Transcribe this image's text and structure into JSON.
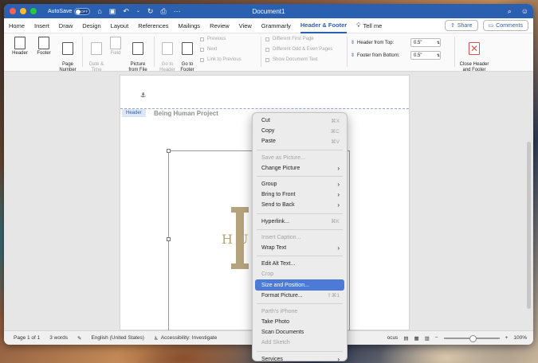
{
  "window": {
    "title": "Document1",
    "autosave_label": "AutoSave",
    "autosave_state": "OFF"
  },
  "menubar": {
    "tabs": [
      "Home",
      "Insert",
      "Draw",
      "Design",
      "Layout",
      "References",
      "Mailings",
      "Review",
      "View",
      "Grammarly",
      "Header & Footer"
    ],
    "active_tab": "Header & Footer",
    "tell_me": "Tell me",
    "share": "Share",
    "comments": "Comments"
  },
  "ribbon": {
    "header": "Header",
    "footer": "Footer",
    "page_number": "Page\nNumber",
    "date_time": "Date &\nTime",
    "field": "Field",
    "picture_from_file": "Picture\nfrom File",
    "go_to_header": "Go to\nHeader",
    "go_to_footer": "Go to\nFooter",
    "previous": "Previous",
    "next": "Next",
    "link_to_previous": "Link to Previous",
    "different_first_page": "Different First Page",
    "different_odd_even": "Different Odd & Even Pages",
    "show_document_text": "Show Document Text",
    "header_from_top_label": "Header from Top:",
    "header_from_top_value": "0.5\"",
    "footer_from_bottom_label": "Footer from Bottom:",
    "footer_from_bottom_value": "0.5\"",
    "close_header_footer": "Close Header\nand Footer"
  },
  "document": {
    "header_tag": "Header",
    "header_text": "Being Human Project",
    "logo_text": "HU"
  },
  "status": {
    "page": "Page 1 of 1",
    "words": "3 words",
    "language": "English (United States)",
    "accessibility": "Accessibility: Investigate",
    "focus": "ocus",
    "zoom": "100%"
  },
  "context_menu": [
    {
      "label": "Cut",
      "shortcut": "⌘X"
    },
    {
      "label": "Copy",
      "shortcut": "⌘C"
    },
    {
      "label": "Paste",
      "shortcut": "⌘V"
    },
    {
      "sep": true
    },
    {
      "label": "Save as Picture...",
      "disabled": true
    },
    {
      "label": "Change Picture",
      "submenu": true
    },
    {
      "sep": true
    },
    {
      "label": "Group",
      "submenu": true
    },
    {
      "label": "Bring to Front",
      "submenu": true
    },
    {
      "label": "Send to Back",
      "submenu": true
    },
    {
      "sep": true
    },
    {
      "label": "Hyperlink...",
      "shortcut": "⌘K"
    },
    {
      "sep": true
    },
    {
      "label": "Insert Caption...",
      "disabled": true
    },
    {
      "label": "Wrap Text",
      "submenu": true
    },
    {
      "sep": true
    },
    {
      "label": "Edit Alt Text..."
    },
    {
      "label": "Crop",
      "disabled": true
    },
    {
      "label": "Size and Position...",
      "selected": true
    },
    {
      "label": "Format Picture...",
      "shortcut": "⇧⌘1"
    },
    {
      "sep": true
    },
    {
      "label": "Parth's iPhone",
      "disabled": true
    },
    {
      "label": "Take Photo"
    },
    {
      "label": "Scan Documents"
    },
    {
      "label": "Add Sketch",
      "disabled": true
    },
    {
      "sep": true
    },
    {
      "label": "Services",
      "submenu": true
    }
  ],
  "colors": {
    "accent": "#2b5fb0",
    "selection": "#4d7ad6",
    "logo": "#b4a37c"
  }
}
